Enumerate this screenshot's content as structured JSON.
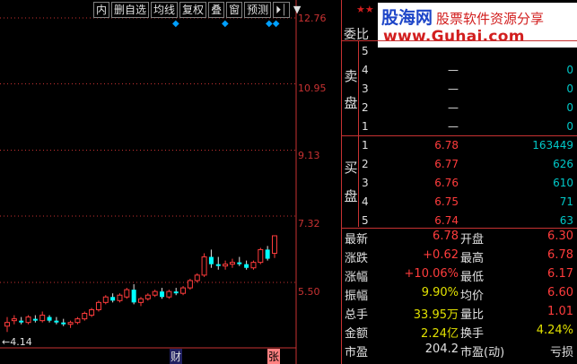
{
  "toolbar": {
    "buttons": [
      "内",
      "删自选",
      "均线",
      "复权",
      "叠",
      "窗",
      "预测"
    ],
    "jump_glyph": "⏵⏐",
    "arrow_glyph": "▼"
  },
  "price_axis": [
    "12.76",
    "10.95",
    "9.13",
    "7.32",
    "5.50"
  ],
  "low_marker": "←4.14",
  "bottom_markers": [
    "财",
    "张"
  ],
  "watermark": {
    "site_name": "股海网",
    "slogan": "股票软件资源分享",
    "url": "www.Guhai.com"
  },
  "webi_label": "委比",
  "side_labels": {
    "sell_1": "卖",
    "sell_2": "盘",
    "buy_1": "买",
    "buy_2": "盘"
  },
  "sell_orders": [
    {
      "n": "5",
      "price": "",
      "vol": ""
    },
    {
      "n": "4",
      "price": "—",
      "vol": "0"
    },
    {
      "n": "3",
      "price": "—",
      "vol": "0"
    },
    {
      "n": "2",
      "price": "—",
      "vol": "0"
    },
    {
      "n": "1",
      "price": "—",
      "vol": "0"
    }
  ],
  "buy_orders": [
    {
      "n": "1",
      "price": "6.78",
      "vol": "163449"
    },
    {
      "n": "2",
      "price": "6.77",
      "vol": "626"
    },
    {
      "n": "3",
      "price": "6.76",
      "vol": "610"
    },
    {
      "n": "4",
      "price": "6.75",
      "vol": "71"
    },
    {
      "n": "5",
      "price": "6.74",
      "vol": "63"
    }
  ],
  "quote": [
    {
      "l1": "最新",
      "v1": "6.78",
      "c1": "red",
      "l2": "开盘",
      "v2": "6.30",
      "c2": "red"
    },
    {
      "l1": "涨跌",
      "v1": "+0.62",
      "c1": "red",
      "l2": "最高",
      "v2": "6.78",
      "c2": "red"
    },
    {
      "l1": "涨幅",
      "v1": "+10.06%",
      "c1": "red",
      "l2": "最低",
      "v2": "6.17",
      "c2": "red"
    },
    {
      "l1": "振幅",
      "v1": "9.90%",
      "c1": "yel",
      "l2": "均价",
      "v2": "6.60",
      "c2": "red"
    },
    {
      "l1": "总手",
      "v1": "33.95万",
      "c1": "yel",
      "l2": "量比",
      "v2": "1.01",
      "c2": "red"
    },
    {
      "l1": "金额",
      "v1": "2.24亿",
      "c1": "yel",
      "l2": "换手",
      "v2": "4.24%",
      "c2": "yel"
    },
    {
      "l1": "市盈",
      "v1": "204.2",
      "c1": "lab",
      "l2": "市盈(动)",
      "v2": "亏损",
      "c2": "lab"
    }
  ],
  "colors": {
    "up": "#ff3c3c",
    "down": "#00ffff",
    "grid": "#c83232",
    "text": "#e0e0e0"
  },
  "chart_data": {
    "type": "candlestick",
    "y_axis_ticks": [
      "12.76",
      "10.95",
      "9.13",
      "7.32",
      "5.50"
    ],
    "ylim": [
      3.9,
      12.76
    ],
    "low_label": "4.14",
    "candles": [
      {
        "o": 4.3,
        "h": 4.55,
        "l": 4.14,
        "c": 4.4
      },
      {
        "o": 4.45,
        "h": 4.6,
        "l": 4.35,
        "c": 4.5
      },
      {
        "o": 4.45,
        "h": 4.55,
        "l": 4.35,
        "c": 4.4
      },
      {
        "o": 4.4,
        "h": 4.6,
        "l": 4.35,
        "c": 4.55
      },
      {
        "o": 4.5,
        "h": 4.6,
        "l": 4.4,
        "c": 4.45
      },
      {
        "o": 4.45,
        "h": 4.7,
        "l": 4.4,
        "c": 4.6
      },
      {
        "o": 4.55,
        "h": 4.6,
        "l": 4.4,
        "c": 4.45
      },
      {
        "o": 4.45,
        "h": 4.55,
        "l": 4.35,
        "c": 4.4
      },
      {
        "o": 4.4,
        "h": 4.5,
        "l": 4.3,
        "c": 4.35
      },
      {
        "o": 4.35,
        "h": 4.45,
        "l": 4.25,
        "c": 4.4
      },
      {
        "o": 4.4,
        "h": 4.55,
        "l": 4.35,
        "c": 4.5
      },
      {
        "o": 4.5,
        "h": 4.7,
        "l": 4.45,
        "c": 4.65
      },
      {
        "o": 4.6,
        "h": 4.8,
        "l": 4.55,
        "c": 4.75
      },
      {
        "o": 4.75,
        "h": 5.0,
        "l": 4.7,
        "c": 4.95
      },
      {
        "o": 4.95,
        "h": 5.15,
        "l": 4.9,
        "c": 5.1
      },
      {
        "o": 5.1,
        "h": 5.2,
        "l": 4.95,
        "c": 5.0
      },
      {
        "o": 5.0,
        "h": 5.2,
        "l": 4.95,
        "c": 5.15
      },
      {
        "o": 5.1,
        "h": 5.35,
        "l": 5.05,
        "c": 5.3
      },
      {
        "o": 5.3,
        "h": 5.45,
        "l": 4.9,
        "c": 4.95
      },
      {
        "o": 4.95,
        "h": 5.1,
        "l": 4.85,
        "c": 5.05
      },
      {
        "o": 5.05,
        "h": 5.2,
        "l": 5.0,
        "c": 5.15
      },
      {
        "o": 5.15,
        "h": 5.3,
        "l": 5.1,
        "c": 5.25
      },
      {
        "o": 5.25,
        "h": 5.35,
        "l": 5.05,
        "c": 5.1
      },
      {
        "o": 5.1,
        "h": 5.3,
        "l": 5.05,
        "c": 5.25
      },
      {
        "o": 5.25,
        "h": 5.35,
        "l": 5.15,
        "c": 5.2
      },
      {
        "o": 5.2,
        "h": 5.4,
        "l": 5.15,
        "c": 5.35
      },
      {
        "o": 5.35,
        "h": 5.6,
        "l": 5.3,
        "c": 5.55
      },
      {
        "o": 5.55,
        "h": 5.75,
        "l": 5.5,
        "c": 5.7
      },
      {
        "o": 5.7,
        "h": 6.3,
        "l": 5.65,
        "c": 6.2
      },
      {
        "o": 6.2,
        "h": 6.4,
        "l": 5.9,
        "c": 6.0
      },
      {
        "o": 6.0,
        "h": 6.2,
        "l": 5.85,
        "c": 5.95
      },
      {
        "o": 5.95,
        "h": 6.1,
        "l": 5.85,
        "c": 6.0
      },
      {
        "o": 6.0,
        "h": 6.15,
        "l": 5.9,
        "c": 6.05
      },
      {
        "o": 6.05,
        "h": 6.2,
        "l": 5.95,
        "c": 6.0
      },
      {
        "o": 6.0,
        "h": 6.1,
        "l": 5.85,
        "c": 5.9
      },
      {
        "o": 5.9,
        "h": 6.1,
        "l": 5.85,
        "c": 6.05
      },
      {
        "o": 6.05,
        "h": 6.45,
        "l": 6.0,
        "c": 6.4
      },
      {
        "o": 6.4,
        "h": 6.5,
        "l": 6.1,
        "c": 6.15
      },
      {
        "o": 6.3,
        "h": 6.78,
        "l": 6.17,
        "c": 6.78
      }
    ]
  }
}
